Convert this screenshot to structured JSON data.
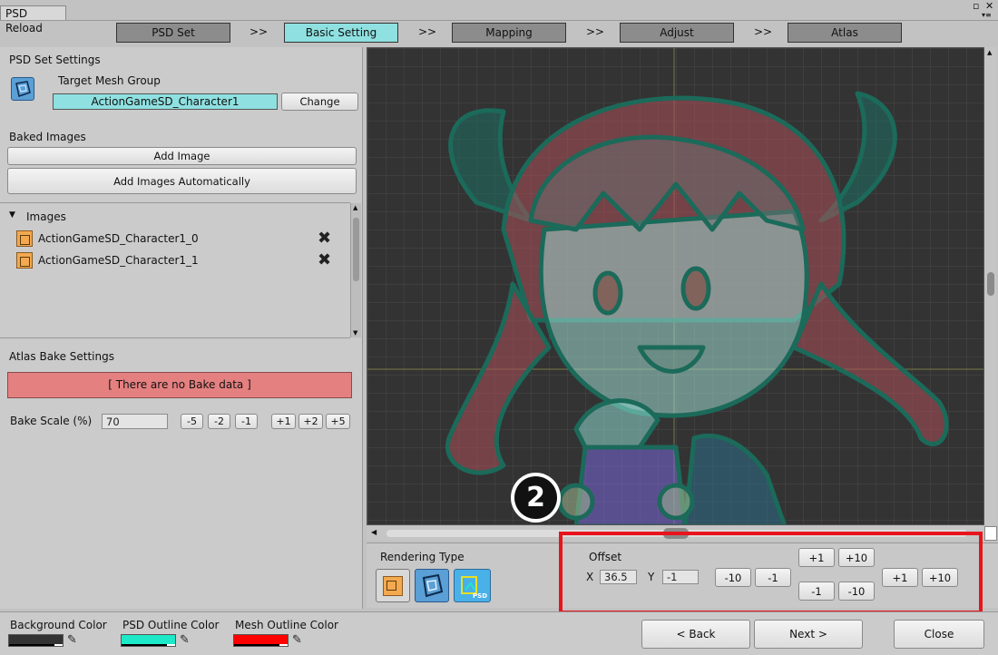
{
  "window": {
    "tab_title": "PSD Reload",
    "controls": [
      "▫",
      "✕"
    ]
  },
  "steps": [
    {
      "label": "PSD Set",
      "active": false
    },
    {
      "label": "Basic Setting",
      "active": true
    },
    {
      "label": "Mapping",
      "active": false
    },
    {
      "label": "Adjust",
      "active": false
    },
    {
      "label": "Atlas",
      "active": false
    }
  ],
  "step_separator": ">>",
  "psd_set": {
    "section_title": "PSD Set Settings",
    "target_label": "Target Mesh Group",
    "target_value": "ActionGameSD_Character1",
    "change_button": "Change"
  },
  "baked": {
    "section_title": "Baked Images",
    "add_image": "Add Image",
    "add_auto": "Add Images Automatically",
    "images_header": "Images",
    "images": [
      "ActionGameSD_Character1_0",
      "ActionGameSD_Character1_1"
    ]
  },
  "atlas": {
    "section_title": "Atlas Bake Settings",
    "no_data": "[ There are no Bake data ]",
    "scale_label": "Bake Scale (%)",
    "scale_value": "70",
    "scale_buttons": [
      "-5",
      "-2",
      "-1",
      "+1",
      "+2",
      "+5"
    ]
  },
  "rendering": {
    "label": "Rendering Type",
    "badge": "PSD"
  },
  "offset": {
    "label": "Offset",
    "x_label": "X",
    "x_value": "36.5",
    "y_label": "Y",
    "y_value": "-1",
    "btn_m10": "-10",
    "btn_m1": "-1",
    "btn_up1": "+1",
    "btn_up10": "+10",
    "btn_dn1": "-1",
    "btn_dn10": "-10",
    "btn_p1": "+1",
    "btn_p10": "+10"
  },
  "marker": "2",
  "colors": {
    "background_label": "Background Color",
    "background": "#333333",
    "psd_outline_label": "PSD Outline Color",
    "psd_outline": "#1de8c8",
    "mesh_outline_label": "Mesh Outline Color",
    "mesh_outline": "#ff0000",
    "highlight": "#e8141c",
    "active_step": "#8fe0e0"
  },
  "nav": {
    "back": "< Back",
    "next": "Next >",
    "close": "Close"
  }
}
